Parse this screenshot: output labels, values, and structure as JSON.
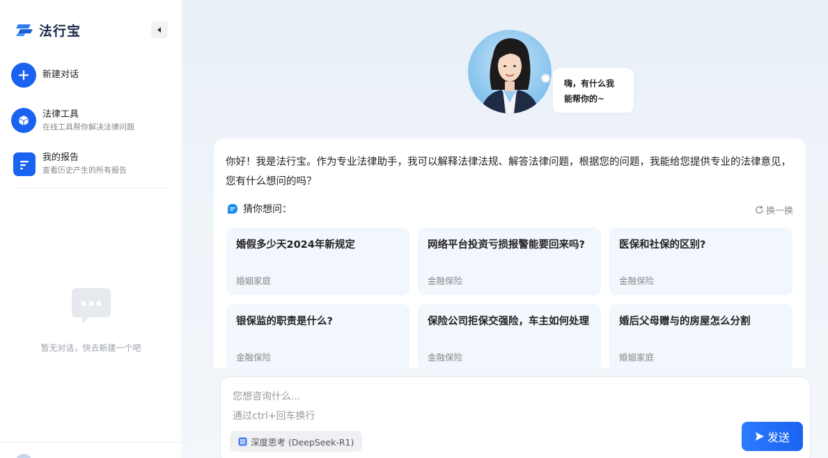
{
  "app": {
    "name": "法行宝"
  },
  "sidebar": {
    "new_chat": {
      "label": "新建对话"
    },
    "items": [
      {
        "title": "法律工具",
        "subtitle": "在线工具帮你解决法律问题"
      },
      {
        "title": "我的报告",
        "subtitle": "查看历史产生的所有报告"
      }
    ],
    "empty_text": "暂无对话，快去新建一个吧"
  },
  "assistant": {
    "bubble_line1": "嗨，有什么我",
    "bubble_line2": "能帮你的~",
    "intro": "你好！我是法行宝。作为专业法律助手，我可以解释法律法规、解答法律问题，根据您的问题，我能给您提供专业的法律意见，您有什么想问的吗？"
  },
  "suggest": {
    "heading": "猜你想问：",
    "refresh_label": "换一换",
    "questions": [
      {
        "title": "婚假多少天2024年新规定",
        "category": "婚姻家庭"
      },
      {
        "title": "网络平台投资亏损报警能要回来吗?",
        "category": "金融保险"
      },
      {
        "title": "医保和社保的区别?",
        "category": "金融保险"
      },
      {
        "title": "银保监的职责是什么?",
        "category": "金融保险"
      },
      {
        "title": "保险公司拒保交强险，车主如何处理",
        "category": "金融保险"
      },
      {
        "title": "婚后父母赠与的房屋怎么分割",
        "category": "婚姻家庭"
      }
    ]
  },
  "composer": {
    "placeholder": "您想咨询什么...\n通过ctrl+回车换行",
    "deep_think_label": "深度思考 (DeepSeek-R1)",
    "send_label": "发送"
  },
  "colors": {
    "accent": "#1a62f0",
    "card_bg": "#f2f6fd",
    "muted_text": "#888888"
  },
  "icons": {
    "logo": "fa-xing-bao-logo",
    "collapse": "caret-left-icon",
    "new_chat": "plus-icon",
    "tools": "cube-icon",
    "reports": "document-icon",
    "empty": "chat-bubble-icon",
    "guess": "chat-icon",
    "refresh": "refresh-icon",
    "deep_think": "atom-icon",
    "send": "send-icon"
  }
}
